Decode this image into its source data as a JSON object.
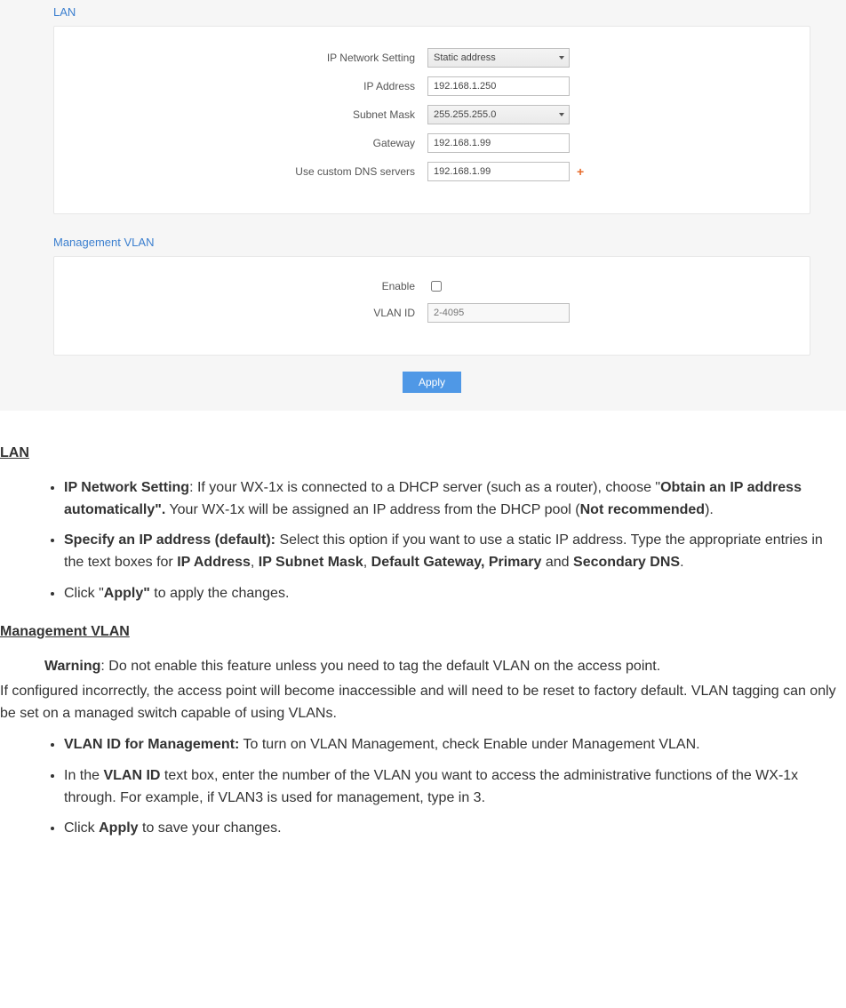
{
  "config": {
    "lan": {
      "title": "LAN",
      "ip_setting_label": "IP Network Setting",
      "ip_setting_value": "Static address",
      "ip_address_label": "IP Address",
      "ip_address_value": "192.168.1.250",
      "subnet_label": "Subnet Mask",
      "subnet_value": "255.255.255.0",
      "gateway_label": "Gateway",
      "gateway_value": "192.168.1.99",
      "dns_label": "Use custom DNS servers",
      "dns_value": "192.168.1.99",
      "plus_glyph": "+"
    },
    "vlan": {
      "title": "Management VLAN",
      "enable_label": "Enable",
      "vlanid_label": "VLAN ID",
      "vlanid_placeholder": "2-4095"
    },
    "apply_label": "Apply"
  },
  "doc": {
    "h1": "LAN",
    "b1": {
      "lead": "IP Network Setting",
      "a": ": If your WX-1x is connected to a DHCP server (such as a router), choose \"",
      "bold1": "Obtain an IP address automatically\".",
      "b": " Your WX-1x will be assigned an IP address from the DHCP pool (",
      "bold2": "Not recommended",
      "c": ")."
    },
    "b2": {
      "lead": "Specify an IP address (default):",
      "a": " Select this option if you want to use a static IP address. Type the appropriate entries in the text boxes for ",
      "bold1": "IP Address",
      "comma1": ", ",
      "bold2": "IP Subnet Mask",
      "comma2": ", ",
      "bold3": "Default Gateway, Primary",
      "b": " and ",
      "bold4": "Secondary DNS",
      "c": "."
    },
    "b3": {
      "a": "Click \"",
      "bold": "Apply\"",
      "b": " to apply the changes."
    },
    "h2": "Management VLAN",
    "warn_lead": "Warning",
    "warn_a": ": Do not enable this feature unless you need to tag the default VLAN on the access point.",
    "warn_b": "If configured incorrectly, the access point will become inaccessible and will need to be reset to factory default. VLAN tagging can only be set on a managed switch capable of using VLANs.",
    "v1": {
      "lead": "VLAN ID for Management:",
      "a": " To turn on VLAN Management, check Enable under Management VLAN."
    },
    "v2": {
      "a": "In the ",
      "bold": "VLAN ID",
      "b": " text box, enter the number of the VLAN you want to access the administrative functions of the WX-1x through. For example, if VLAN3 is used for management, type in 3."
    },
    "v3": {
      "a": "Click ",
      "bold": "Apply",
      "b": " to save your changes."
    }
  }
}
